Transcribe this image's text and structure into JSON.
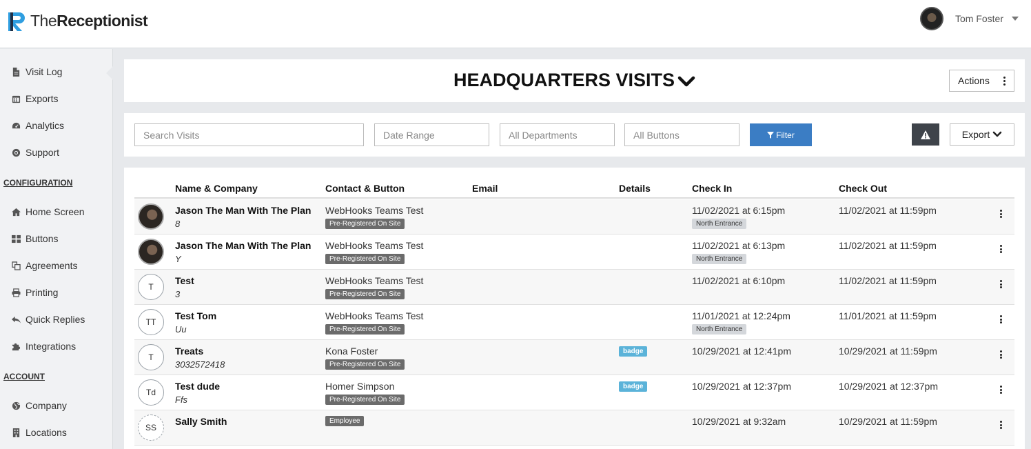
{
  "app": {
    "logo_letter": "R",
    "brand_prefix": "The",
    "brand_name": "Receptionist",
    "user_name": "Tom Foster"
  },
  "sidebar": {
    "items": [
      {
        "label": "Visit Log",
        "icon": "file-icon"
      },
      {
        "label": "Exports",
        "icon": "calendar-icon"
      },
      {
        "label": "Analytics",
        "icon": "dashboard-icon"
      },
      {
        "label": "Support",
        "icon": "lifebuoy-icon"
      }
    ],
    "config_heading": "CONFIGURATION",
    "config_items": [
      {
        "label": "Home Screen",
        "icon": "home-icon"
      },
      {
        "label": "Buttons",
        "icon": "grid-icon"
      },
      {
        "label": "Agreements",
        "icon": "copy-icon"
      },
      {
        "label": "Printing",
        "icon": "printer-icon"
      },
      {
        "label": "Quick Replies",
        "icon": "reply-icon"
      },
      {
        "label": "Integrations",
        "icon": "puzzle-icon"
      }
    ],
    "account_heading": "ACCOUNT",
    "account_items": [
      {
        "label": "Company",
        "icon": "globe-icon"
      },
      {
        "label": "Locations",
        "icon": "building-icon"
      }
    ]
  },
  "header": {
    "title": "HEADQUARTERS VISITS",
    "actions_label": "Actions"
  },
  "filters": {
    "search_placeholder": "Search Visits",
    "date_placeholder": "Date Range",
    "departments_placeholder": "All Departments",
    "buttons_placeholder": "All Buttons",
    "filter_label": "Filter",
    "export_label": "Export"
  },
  "table": {
    "columns": [
      "Name & Company",
      "Contact & Button",
      "Email",
      "Details",
      "Check In",
      "Check Out"
    ],
    "rows": [
      {
        "avatar": "",
        "name": "Jason The Man With The Plan",
        "sub": "8",
        "contact": "WebHooks Teams Test",
        "button_tag": "Pre-Registered On Site",
        "details": "",
        "check_in": "11/02/2021 at 6:15pm",
        "location": "North Entrance",
        "check_out": "11/02/2021 at 11:59pm"
      },
      {
        "avatar": "",
        "name": "Jason The Man With The Plan",
        "sub": "Y",
        "contact": "WebHooks Teams Test",
        "button_tag": "Pre-Registered On Site",
        "details": "",
        "check_in": "11/02/2021 at 6:13pm",
        "location": "North Entrance",
        "check_out": "11/02/2021 at 11:59pm"
      },
      {
        "avatar": "T",
        "name": "Test",
        "sub": "3",
        "contact": "WebHooks Teams Test",
        "button_tag": "Pre-Registered On Site",
        "details": "",
        "check_in": "11/02/2021 at 6:10pm",
        "location": "",
        "check_out": "11/02/2021 at 11:59pm"
      },
      {
        "avatar": "TT",
        "name": "Test Tom",
        "sub": "Uu",
        "contact": "WebHooks Teams Test",
        "button_tag": "Pre-Registered On Site",
        "details": "",
        "check_in": "11/01/2021 at 12:24pm",
        "location": "North Entrance",
        "check_out": "11/01/2021 at 11:59pm"
      },
      {
        "avatar": "T",
        "name": "Treats",
        "sub": "3032572418",
        "contact": "Kona Foster",
        "button_tag": "Pre-Registered On Site",
        "details": "badge",
        "check_in": "10/29/2021 at 12:41pm",
        "location": "",
        "check_out": "10/29/2021 at 11:59pm"
      },
      {
        "avatar": "Td",
        "name": "Test dude",
        "sub": "Ffs",
        "contact": "Homer Simpson",
        "button_tag": "Pre-Registered On Site",
        "details": "badge",
        "check_in": "10/29/2021 at 12:37pm",
        "location": "",
        "check_out": "10/29/2021 at 12:37pm"
      },
      {
        "avatar": "SS",
        "name": "Sally Smith",
        "sub": "",
        "contact": "",
        "button_tag": "Employee",
        "details": "",
        "check_in": "10/29/2021 at 9:32am",
        "location": "",
        "check_out": "10/29/2021 at 11:59pm"
      }
    ]
  },
  "colors": {
    "accent": "#3b7dc4",
    "badge": "#5bb3d9",
    "tag_dark": "#6b6b6b",
    "logo_blue": "#2f9ee0",
    "logo_dark": "#1f2f46"
  }
}
